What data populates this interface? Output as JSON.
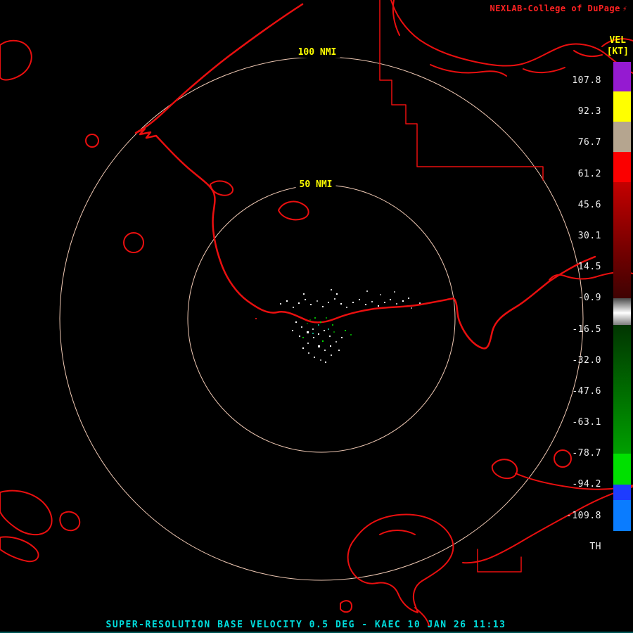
{
  "header": {
    "brand": "NEXLAB-College of DuPage",
    "brand_glyph": "⚡",
    "brand_color": "#ff2222"
  },
  "colorbar": {
    "title": "VEL",
    "units": "[KT]",
    "ticks": [
      "107.8",
      "92.3",
      "76.7",
      "61.2",
      "45.6",
      "30.1",
      "14.5",
      "-0.9",
      "-16.5",
      "-32.0",
      "-47.6",
      "-63.1",
      "-78.7",
      "-94.2",
      "-109.8"
    ],
    "threshold_label": "TH",
    "segments": [
      {
        "h": 42,
        "color": "#951ad1"
      },
      {
        "h": 43,
        "color": "#ffff00"
      },
      {
        "h": 43,
        "color": "#b5a58f"
      },
      {
        "h": 43,
        "color": "#fb0000"
      },
      {
        "h": 165,
        "color": "linear-gradient(#c40000,#7a0000 55%,#3f0202)"
      },
      {
        "h": 38,
        "color": "linear-gradient(#4a4a4a,#ffffff 55%,#7d7d7d)"
      },
      {
        "h": 183,
        "color": "linear-gradient(#013501,#00a000)"
      },
      {
        "h": 44,
        "color": "#00e000"
      },
      {
        "h": 22,
        "color": "#1e3cff"
      },
      {
        "h": 44,
        "color": "#0a7cff"
      },
      {
        "h": 35,
        "color": "#000000"
      }
    ]
  },
  "range_rings": [
    {
      "label": "100 NMI"
    },
    {
      "label": "50 NMI"
    }
  ],
  "map": {
    "line_color": "#e90f0f",
    "ring_color": "#f0c9b4",
    "label_color": "#ffff00"
  },
  "statusbar": {
    "text": "SUPER-RESOLUTION BASE VELOCITY 0.5 DEG - KAEC 10 JAN 26 11:13",
    "color": "#00dcdc"
  },
  "echoes": [
    [
      398,
      431,
      2,
      "#dcdcdc"
    ],
    [
      407,
      427,
      2,
      "#ffffff"
    ],
    [
      416,
      436,
      2,
      "#bfbfbf"
    ],
    [
      424,
      430,
      2,
      "#ffffff"
    ],
    [
      433,
      425,
      2,
      "#d8d8d8"
    ],
    [
      441,
      432,
      2,
      "#ffffff"
    ],
    [
      450,
      427,
      2,
      "#a8a8a8"
    ],
    [
      458,
      435,
      2,
      "#ffffff"
    ],
    [
      466,
      429,
      2,
      "#e6e6e6"
    ],
    [
      475,
      424,
      2,
      "#cccccc"
    ],
    [
      484,
      431,
      2,
      "#ffffff"
    ],
    [
      492,
      436,
      2,
      "#bbbbbb"
    ],
    [
      501,
      429,
      2,
      "#ffffff"
    ],
    [
      510,
      425,
      2,
      "#d2d2d2"
    ],
    [
      519,
      432,
      2,
      "#ffffff"
    ],
    [
      528,
      428,
      2,
      "#c6c6c6"
    ],
    [
      537,
      434,
      2,
      "#ffffff"
    ],
    [
      546,
      429,
      2,
      "#e0e0e0"
    ],
    [
      554,
      425,
      2,
      "#ffffff"
    ],
    [
      563,
      431,
      2,
      "#b4b4b4"
    ],
    [
      572,
      427,
      2,
      "#ffffff"
    ],
    [
      580,
      423,
      2,
      "#d6d6d6"
    ],
    [
      560,
      414,
      2,
      "#9e9e9e"
    ],
    [
      470,
      411,
      2,
      "#cfcfcf"
    ],
    [
      478,
      417,
      2,
      "#ffffff"
    ],
    [
      521,
      413,
      2,
      "#c2c2c2"
    ],
    [
      431,
      417,
      2,
      "#e9e9e9"
    ],
    [
      540,
      418,
      2,
      "#8f8f8f"
    ],
    [
      584,
      437,
      2,
      "#8a8a8a"
    ],
    [
      596,
      430,
      2,
      "#cccccc"
    ],
    [
      420,
      457,
      2,
      "#ffffff"
    ],
    [
      428,
      464,
      2,
      "#d0d0d0"
    ],
    [
      436,
      471,
      3,
      "#ffffff"
    ],
    [
      444,
      467,
      2,
      "#bdbdbd"
    ],
    [
      452,
      474,
      2,
      "#ffffff"
    ],
    [
      460,
      469,
      2,
      "#e3e3e3"
    ],
    [
      445,
      479,
      2,
      "#ffffff"
    ],
    [
      437,
      487,
      2,
      "#c9c9c9"
    ],
    [
      452,
      491,
      3,
      "#ffffff"
    ],
    [
      461,
      497,
      2,
      "#d5d5d5"
    ],
    [
      469,
      491,
      2,
      "#ffffff"
    ],
    [
      477,
      485,
      2,
      "#b0b0b0"
    ],
    [
      485,
      479,
      2,
      "#ffffff"
    ],
    [
      468,
      477,
      2,
      "#dadada"
    ],
    [
      430,
      494,
      2,
      "#ffffff"
    ],
    [
      438,
      501,
      2,
      "#c4c4c4"
    ],
    [
      446,
      507,
      2,
      "#ffffff"
    ],
    [
      455,
      511,
      2,
      "#9b9b9b"
    ],
    [
      425,
      477,
      2,
      "#e7e7e7"
    ],
    [
      415,
      469,
      2,
      "#ffffff"
    ],
    [
      470,
      504,
      2,
      "#cacaca"
    ],
    [
      462,
      514,
      2,
      "#ffffff"
    ],
    [
      481,
      497,
      2,
      "#dddddd"
    ],
    [
      447,
      451,
      2,
      "#00b400"
    ],
    [
      455,
      457,
      2,
      "#00d000"
    ],
    [
      463,
      451,
      2,
      "#008a00"
    ],
    [
      472,
      461,
      2,
      "#00b400"
    ],
    [
      440,
      454,
      2,
      "#006e00"
    ],
    [
      490,
      469,
      2,
      "#00c800"
    ],
    [
      498,
      475,
      2,
      "#009600"
    ],
    [
      430,
      479,
      2,
      "#00b400"
    ],
    [
      458,
      484,
      2,
      "#00dc00"
    ],
    [
      452,
      461,
      2,
      "#0fa37f"
    ],
    [
      466,
      467,
      2,
      "#12b28a"
    ],
    [
      444,
      473,
      2,
      "#0fa37f"
    ],
    [
      436,
      459,
      2,
      "#005a00"
    ],
    [
      474,
      471,
      2,
      "#007800"
    ],
    [
      363,
      452,
      2,
      "#cf1111"
    ]
  ]
}
